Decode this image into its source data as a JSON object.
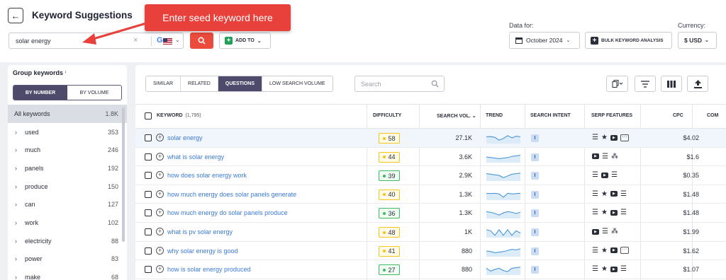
{
  "header": {
    "title": "Keyword Suggestions",
    "search_value": "solar energy",
    "add_to_label": "ADD TO",
    "data_for_label": "Data for:",
    "date_value": "October 2024",
    "bulk_label": "BULK KEYWORD ANALYSIS",
    "currency_label": "Currency:",
    "currency_value": "$ USD"
  },
  "callout": {
    "text": "Enter seed keyword here",
    "color": "#e8403a"
  },
  "left_panel": {
    "title": "Group keywords",
    "title_mark": "ⁱ",
    "toggle_on": "BY NUMBER",
    "toggle_off": "BY VOLUME",
    "groups": [
      {
        "label": "All keywords",
        "count": "1.8K"
      },
      {
        "label": "used",
        "count": "353"
      },
      {
        "label": "much",
        "count": "246"
      },
      {
        "label": "panels",
        "count": "192"
      },
      {
        "label": "produce",
        "count": "150"
      },
      {
        "label": "can",
        "count": "127"
      },
      {
        "label": "work",
        "count": "102"
      },
      {
        "label": "electricity",
        "count": "88"
      },
      {
        "label": "power",
        "count": "83"
      },
      {
        "label": "make",
        "count": "68"
      }
    ]
  },
  "tabs": [
    "SIMILAR",
    "RELATED",
    "QUESTIONS",
    "LOW SEARCH VOLUME"
  ],
  "active_tab": "QUESTIONS",
  "table_search_placeholder": "Search",
  "table": {
    "headers": {
      "keyword": "KEYWORD",
      "keyword_count": "(1,795)",
      "difficulty": "DIFFICULTY",
      "volume": "SEARCH VOL.",
      "trend": "TREND",
      "intent": "SEARCH INTENT",
      "serp": "SERP FEATURES",
      "cpc": "CPC",
      "comp": "COM"
    },
    "rows": [
      {
        "keyword": "solar energy",
        "difficulty": "58",
        "volume": "27.1K",
        "intent": "I",
        "cpc": "$4.02",
        "serp": [
          "list",
          "star",
          "video",
          "more"
        ],
        "trend": [
          0.6,
          0.62,
          0.55,
          0.3,
          0.45,
          0.7,
          0.5,
          0.65,
          0.6
        ]
      },
      {
        "keyword": "what is solar energy",
        "difficulty": "44",
        "volume": "3.6K",
        "intent": "I",
        "cpc": "$1.6",
        "serp": [
          "video",
          "list",
          "tree"
        ],
        "trend": [
          0.5,
          0.45,
          0.4,
          0.35,
          0.4,
          0.45,
          0.55,
          0.6,
          0.65
        ]
      },
      {
        "keyword": "how does solar energy work",
        "difficulty": "39",
        "volume": "2.9K",
        "intent": "I",
        "cpc": "$0.35",
        "serp": [
          "list",
          "video",
          "list"
        ],
        "trend": [
          0.65,
          0.6,
          0.55,
          0.5,
          0.3,
          0.45,
          0.6,
          0.65,
          0.7
        ]
      },
      {
        "keyword": "how much energy does solar panels generate",
        "difficulty": "40",
        "volume": "1.3K",
        "intent": "I",
        "cpc": "$1.48",
        "serp": [
          "list",
          "star",
          "video",
          "list"
        ],
        "trend": [
          0.6,
          0.58,
          0.6,
          0.55,
          0.25,
          0.6,
          0.55,
          0.58,
          0.6
        ]
      },
      {
        "keyword": "how much energy do solar panels produce",
        "difficulty": "36",
        "volume": "1.3K",
        "intent": "I",
        "cpc": "$1.48",
        "serp": [
          "list",
          "star",
          "video",
          "list"
        ],
        "trend": [
          0.6,
          0.55,
          0.45,
          0.3,
          0.5,
          0.6,
          0.55,
          0.45,
          0.55
        ]
      },
      {
        "keyword": "what is pv solar energy",
        "difficulty": "48",
        "volume": "1K",
        "intent": "I",
        "cpc": "$1.99",
        "serp": [
          "video",
          "list",
          "tree"
        ],
        "trend": [
          0.7,
          0.6,
          0.2,
          0.7,
          0.2,
          0.7,
          0.2,
          0.6,
          0.4
        ]
      },
      {
        "keyword": "why solar energy is good",
        "difficulty": "41",
        "volume": "880",
        "intent": "I",
        "cpc": "$1.62",
        "serp": [
          "list",
          "star",
          "video",
          "more"
        ],
        "trend": [
          0.5,
          0.45,
          0.35,
          0.4,
          0.45,
          0.55,
          0.65,
          0.6,
          0.7
        ]
      },
      {
        "keyword": "how is solar energy produced",
        "difficulty": "27",
        "volume": "880",
        "intent": "I",
        "cpc": "$1.07",
        "serp": [
          "list",
          "star",
          "video",
          "list"
        ],
        "trend": [
          0.6,
          0.35,
          0.5,
          0.6,
          0.4,
          0.3,
          0.6,
          0.65,
          0.7
        ]
      }
    ]
  },
  "colors": {
    "accent": "#4e4a6b",
    "red_button": "#ea4b3c",
    "link": "#3a7bd5",
    "diff_yellow": "#f5c518",
    "diff_green": "#3dbb5e",
    "trend_line": "#3a8fd8",
    "trend_fill": "#dcebf8"
  }
}
